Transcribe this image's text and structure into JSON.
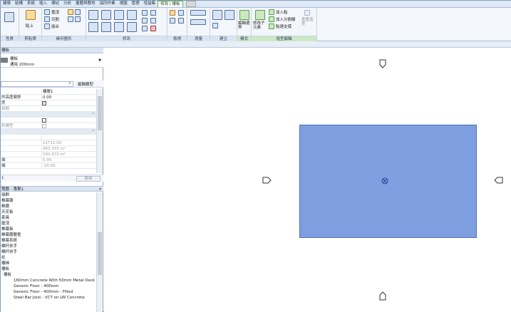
{
  "tabs": [
    "建築",
    "結構",
    "系統",
    "插入",
    "標註",
    "分析",
    "量體與敷地",
    "協同作業",
    "視圖",
    "管理",
    "增益集",
    "修改 | 樓板"
  ],
  "active_tab": "修改 | 樓板",
  "ribbon": {
    "panels": [
      "性質",
      "剪貼簿",
      "幾何圖形",
      "修改",
      "檢視",
      "測量",
      "建立",
      "模式",
      "造型編輯"
    ],
    "clipboard_items": [
      "貼上"
    ],
    "geometry_items": [
      "蓋頂",
      "切割",
      "接合"
    ],
    "mode_item": "編輯邊界",
    "shape_items": {
      "modify_sub": "修改子元素",
      "add_point": "加入點",
      "add_split": "加入分割線",
      "pick_supports": "點選支撐",
      "reset_shape": "重置造型"
    }
  },
  "properties": {
    "header": "樓板",
    "type_name": "樓板",
    "type_sub": "通用 200mm",
    "edit_type": "編輯類型",
    "rows": [
      {
        "key": "",
        "value": "樓層1",
        "section": false
      },
      {
        "key": "的高度偏移",
        "value": "0.00",
        "section": false
      },
      {
        "key": "房",
        "value": "",
        "checkbox": true,
        "checked": true,
        "section": false
      },
      {
        "key": "相關",
        "value": "",
        "checkbox": true,
        "checked": false,
        "section": false,
        "gray": true
      },
      {
        "key": "",
        "value": "",
        "section": true
      },
      {
        "key": "",
        "value": "",
        "checkbox": true,
        "checked": false,
        "section": false
      },
      {
        "key": "析模型",
        "value": "",
        "checkbox": true,
        "checked": false,
        "section": false,
        "gray": true
      },
      {
        "key": "",
        "value": "",
        "section": true
      },
      {
        "key": "",
        "value": "",
        "section": false
      },
      {
        "key": "",
        "value": "12712.00",
        "section": false,
        "gray": true
      },
      {
        "key": "",
        "value": "962.355 m²",
        "section": false,
        "gray": true
      },
      {
        "key": "",
        "value": "192.472 m³",
        "section": false,
        "gray": true
      },
      {
        "key": "端",
        "value": "0.00",
        "section": false,
        "gray": true
      },
      {
        "key": "端",
        "value": "-20.00",
        "section": false,
        "gray": true
      }
    ],
    "help": "1",
    "apply": "套用"
  },
  "project_browser": {
    "header": "覽器 - 專案1",
    "items": [
      {
        "label": "接群",
        "level": 0
      },
      {
        "label": "帷幕牆",
        "level": 0
      },
      {
        "label": "帳牆",
        "level": 0
      },
      {
        "label": "天花板",
        "level": 0
      },
      {
        "label": "家具",
        "level": 0
      },
      {
        "label": "屋頂",
        "level": 0
      },
      {
        "label": "帷幕板",
        "level": 0
      },
      {
        "label": "帷幕牆豎框",
        "level": 0
      },
      {
        "label": "帷幕系統",
        "level": 0
      },
      {
        "label": "欄杆扶手",
        "level": 0
      },
      {
        "label": "欄杆扶手",
        "level": 0
      },
      {
        "label": "柱",
        "level": 0
      },
      {
        "label": "樓梯",
        "level": 0
      },
      {
        "label": "樓板",
        "level": 0
      },
      {
        "label": "樓板",
        "level": 1
      },
      {
        "label": "160mm Concrete With 50mm Metal Deck",
        "level": 2
      },
      {
        "label": "Generic Floor - 400mm",
        "level": 2
      },
      {
        "label": "Generic Floor - 400mm - Filled",
        "level": 2
      },
      {
        "label": "Steel Bar Joist - VCT on LW Concrete",
        "level": 2
      }
    ]
  },
  "colors": {
    "floor_fill": "#7f9edf",
    "floor_edge": "#4f6fb8",
    "context_tab": "#b8e0b0"
  },
  "canvas_icons": [
    "elevation-marker-north-icon",
    "elevation-marker-west-icon",
    "elevation-marker-east-icon",
    "elevation-marker-south-icon",
    "floor-center-icon"
  ]
}
